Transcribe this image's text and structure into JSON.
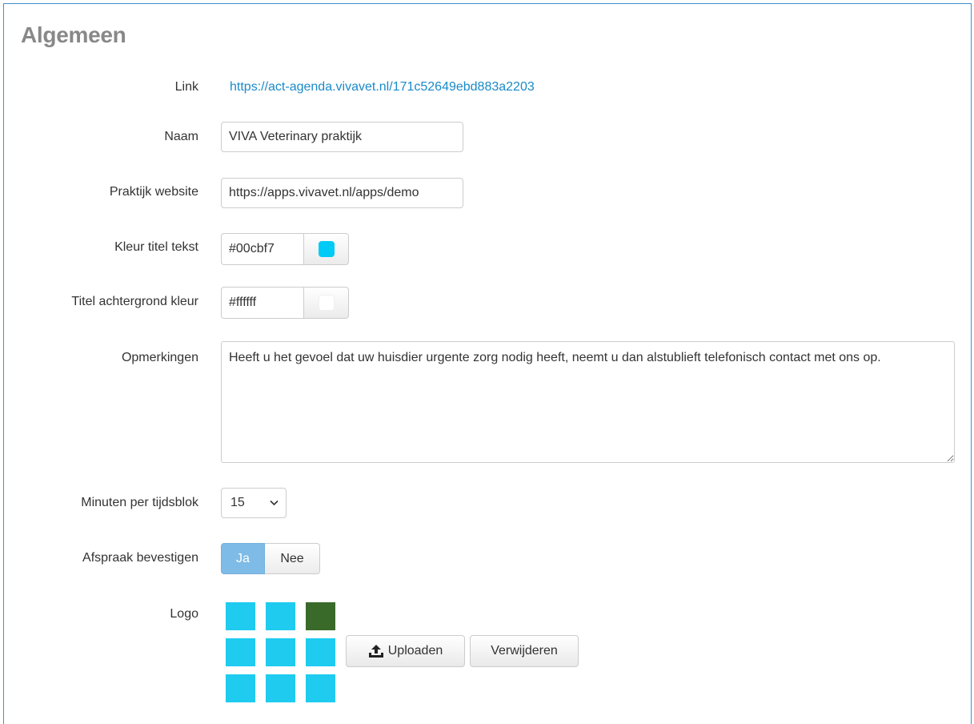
{
  "section": {
    "title": "Algemeen"
  },
  "labels": {
    "link": "Link",
    "naam": "Naam",
    "website": "Praktijk website",
    "kleur_titel": "Kleur titel tekst",
    "titel_achtergrond": "Titel achtergrond kleur",
    "opmerkingen": "Opmerkingen",
    "minuten": "Minuten per tijdsblok",
    "bevestigen": "Afspraak bevestigen",
    "logo": "Logo"
  },
  "link_url": "https://act-agenda.vivavet.nl/171c52649ebd883a2203",
  "naam_value": "VIVA Veterinary praktijk",
  "website_value": "https://apps.vivavet.nl/apps/demo",
  "kleur_titel_value": "#00cbf7",
  "titel_achtergrond_value": "#ffffff",
  "opmerkingen_value": "Heeft u het gevoel dat uw huisdier urgente zorg nodig heeft, neemt u dan alstublieft telefonisch contact met ons op.",
  "minuten_selected": "15",
  "bevestigen": {
    "yes": "Ja",
    "no": "Nee",
    "selected": "Ja"
  },
  "buttons": {
    "upload": "Uploaden",
    "remove": "Verwijderen"
  },
  "icons": {
    "upload": "upload-icon",
    "dropdown": "chevron-down-icon",
    "resize": "resize-handle-icon"
  },
  "colors": {
    "link": "#1a8ac9",
    "panel_border": "#3f8fd0",
    "toggle_active": "#7ebbe6",
    "logo_cyan": "#1fcbef",
    "logo_green": "#3a6a2a"
  }
}
